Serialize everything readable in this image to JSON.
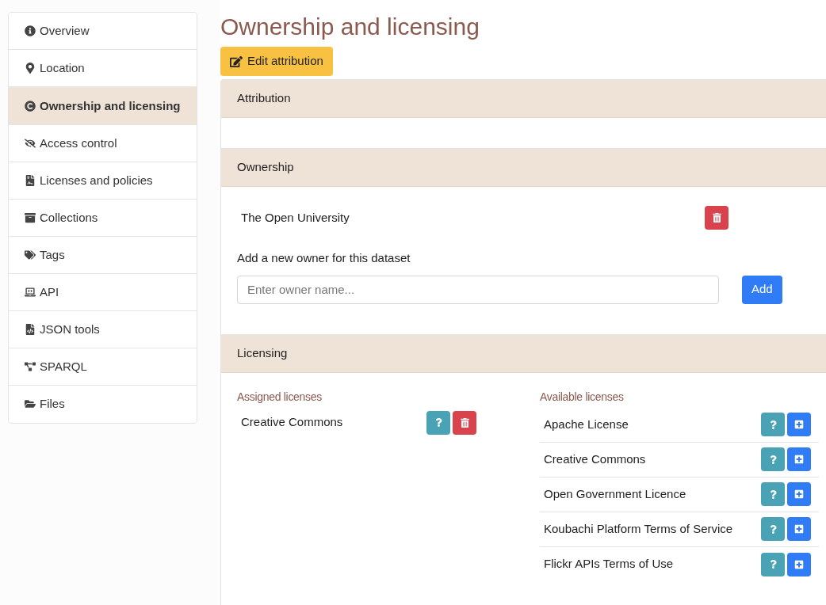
{
  "sidebar": {
    "items": [
      {
        "label": "Overview",
        "selected": false
      },
      {
        "label": "Location",
        "selected": false
      },
      {
        "label": "Ownership and licensing",
        "selected": true
      },
      {
        "label": "Access control",
        "selected": false
      },
      {
        "label": "Licenses and policies",
        "selected": false
      },
      {
        "label": "Collections",
        "selected": false
      },
      {
        "label": "Tags",
        "selected": false
      },
      {
        "label": "API",
        "selected": false
      },
      {
        "label": "JSON tools",
        "selected": false
      },
      {
        "label": "SPARQL",
        "selected": false
      },
      {
        "label": "Files",
        "selected": false
      }
    ]
  },
  "title": "Ownership and licensing",
  "edit_button": "Edit attribution",
  "attribution": {
    "header": "Attribution"
  },
  "ownership": {
    "header": "Ownership",
    "owners": [
      "The Open University"
    ],
    "add_label": "Add a new owner for this dataset",
    "input": {
      "placeholder": "Enter owner name..."
    },
    "add_button": "Add"
  },
  "licensing": {
    "header": "Licensing",
    "assigned_title": "Assigned licenses",
    "assigned": [
      "Creative Commons"
    ],
    "available_title": "Available licenses",
    "available": [
      "Apache License",
      "Creative Commons",
      "Open Government Licence",
      "Koubachi Platform Terms of Service",
      "Flickr APIs Terms of Use"
    ]
  }
}
